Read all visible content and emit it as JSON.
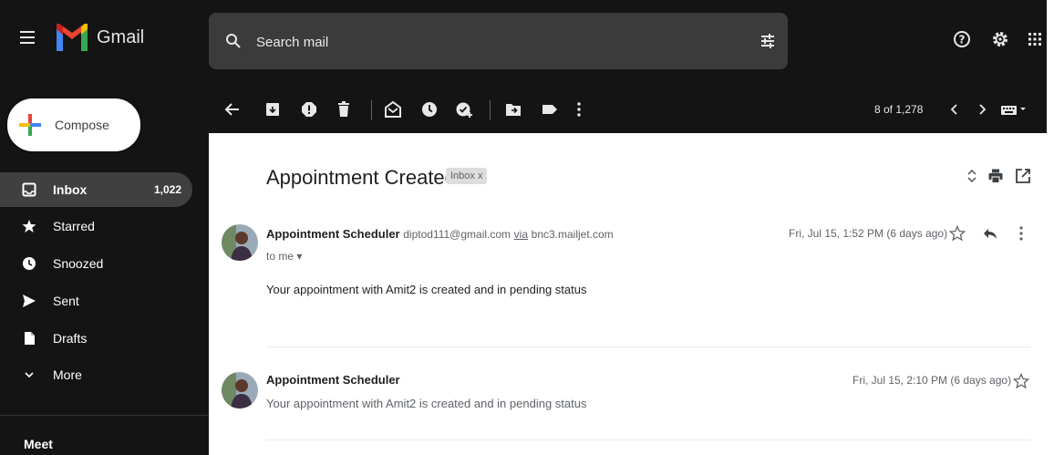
{
  "app": {
    "name": "Gmail"
  },
  "search": {
    "placeholder": "Search mail"
  },
  "icons": {
    "menu": "hamburger-menu-icon",
    "search": "search-icon",
    "filter": "search-options-icon",
    "help": "help-icon",
    "settings": "settings-gear-icon",
    "apps": "apps-grid-icon"
  },
  "compose": {
    "label": "Compose"
  },
  "sidebar": {
    "items": [
      {
        "label": "Inbox",
        "count": "1,022",
        "icon": "inbox-icon",
        "active": true
      },
      {
        "label": "Starred",
        "icon": "star-icon"
      },
      {
        "label": "Snoozed",
        "icon": "clock-icon"
      },
      {
        "label": "Sent",
        "icon": "send-icon"
      },
      {
        "label": "Drafts",
        "icon": "draft-icon"
      },
      {
        "label": "More",
        "icon": "chevron-down-icon"
      }
    ],
    "meet": "Meet"
  },
  "toolbar": {
    "pager": "8 of 1,278",
    "actions": [
      "back",
      "archive",
      "report-spam",
      "delete",
      "mark-unread",
      "snooze",
      "add-to-tasks",
      "move-to",
      "labels",
      "more"
    ]
  },
  "thread": {
    "subject": "Appointment Created",
    "label_chip": "Inbox x",
    "messages": [
      {
        "sender": "Appointment Scheduler",
        "email": "diptod111@gmail.com",
        "via_word": "via",
        "via_domain": "bnc3.mailjet.com",
        "to": "to me",
        "date": "Fri, Jul 15, 1:52 PM (6 days ago)",
        "body": "Your appointment with Amit2 is created and in pending status"
      },
      {
        "sender": "Appointment Scheduler",
        "date": "Fri, Jul 15, 2:10 PM (6 days ago)",
        "snippet": "Your appointment with Amit2 is created and in pending status"
      }
    ]
  },
  "colors": {
    "background": "#141414",
    "search_bg": "#3b3b3b",
    "active_nav": "#404040",
    "pane": "#ffffff",
    "gmail_red": "#ea4335",
    "gmail_blue": "#4285f4",
    "gmail_green": "#34a853",
    "gmail_yellow": "#fbbc04"
  }
}
